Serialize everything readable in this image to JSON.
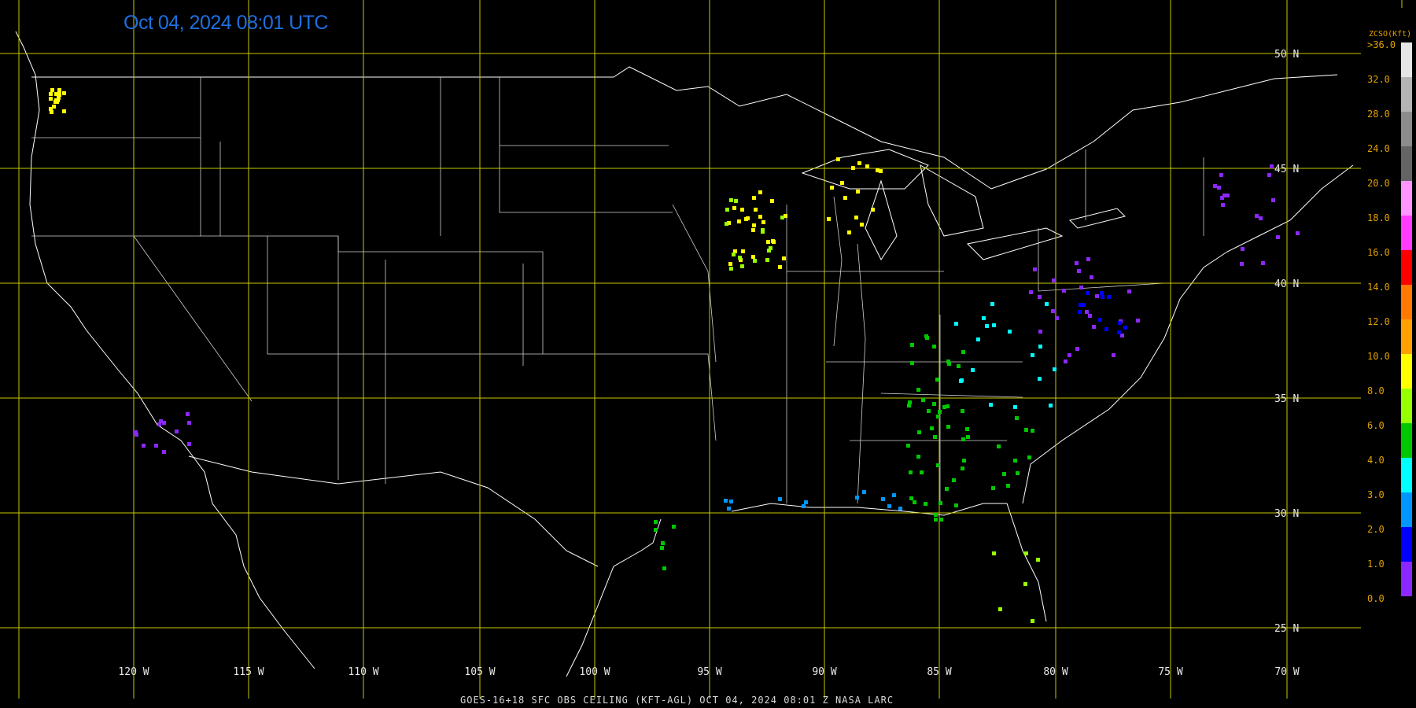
{
  "timestamp": "Oct 04, 2024 08:01 UTC",
  "footer": "GOES-16+18  SFC OBS CEILING (KFT-AGL)   OCT 04, 2024 08:01 Z   NASA LARC",
  "grid_color": "#c8c800",
  "coast_color": "#ffffff",
  "longitude_labels": [
    "120 W",
    "115 W",
    "110 W",
    "105 W",
    "100 W",
    "95 W",
    "90 W",
    "85 W",
    "80 W",
    "75 W",
    "70 W"
  ],
  "latitude_labels": [
    "50 N",
    "45 N",
    "40 N",
    "35 N",
    "30 N",
    "25 N"
  ],
  "legend": {
    "title": "ZCSO(Kft)",
    "labels": [
      ">36.0",
      "32.0",
      "28.0",
      "24.0",
      "20.0",
      "18.0",
      "16.0",
      "14.0",
      "12.0",
      "10.0",
      "8.0",
      "6.0",
      "4.0",
      "3.0",
      "2.0",
      "1.0",
      "0.0"
    ],
    "colors": [
      "#e6e6e6",
      "#b4b4b4",
      "#8c8c8c",
      "#646464",
      "#ff96ff",
      "#ff3cff",
      "#ff0000",
      "#ff7800",
      "#ffa000",
      "#ffff00",
      "#96ff00",
      "#00c800",
      "#00ffff",
      "#0096ff",
      "#0000ff",
      "#8c28ff",
      "#8c28ff"
    ]
  }
}
